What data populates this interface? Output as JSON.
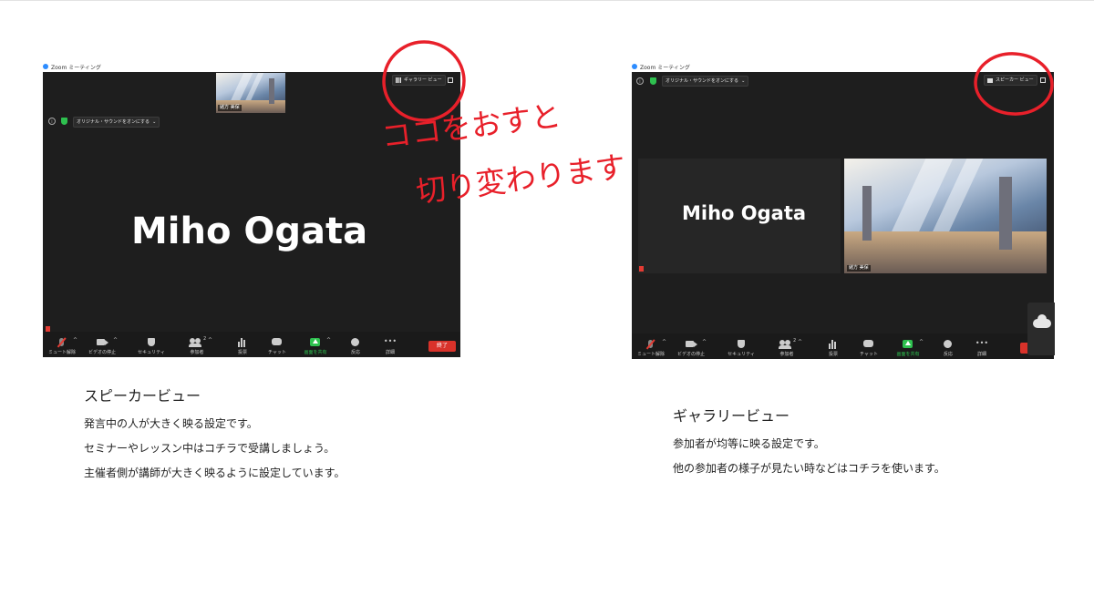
{
  "left_window": {
    "title": "Zoom ミーティング",
    "view_button": "ギャラリー ビュー",
    "audio_option": "オリジナル・サウンドをオンにする",
    "speaker_name": "Miho Ogata",
    "thumb_name": "緒方 美保",
    "toolbar": [
      "ミュート解除",
      "ビデオの停止",
      "セキュリティ",
      "参加者",
      "投票",
      "チャット",
      "画面を共有",
      "反応",
      "詳細"
    ],
    "participants_count": "2",
    "end_label": "終了"
  },
  "right_window": {
    "title": "Zoom ミーティング",
    "view_button": "スピーカー ビュー",
    "audio_option": "オリジナル・サウンドをオンにする",
    "tile_name": "Miho Ogata",
    "video_name": "緒方 美保",
    "toolbar": [
      "ミュート解除",
      "ビデオの停止",
      "セキュリティ",
      "参加者",
      "投票",
      "チャット",
      "画面を共有",
      "反応",
      "詳細"
    ],
    "participants_count": "2"
  },
  "annotation": {
    "line1": "ココをおすと",
    "line2": "切り変わります",
    "color": "#e8202a"
  },
  "speaker_caption": {
    "title": "スピーカービュー",
    "lines": [
      "発言中の人が大きく映る設定です。",
      "セミナーやレッスン中はコチラで受講しましょう。",
      "主催者側が講師が大きく映るように設定しています。"
    ]
  },
  "gallery_caption": {
    "title": "ギャラリービュー",
    "lines": [
      "参加者が均等に映る設定です。",
      "他の参加者の様子が見たい時などはコチラを使います。"
    ]
  }
}
